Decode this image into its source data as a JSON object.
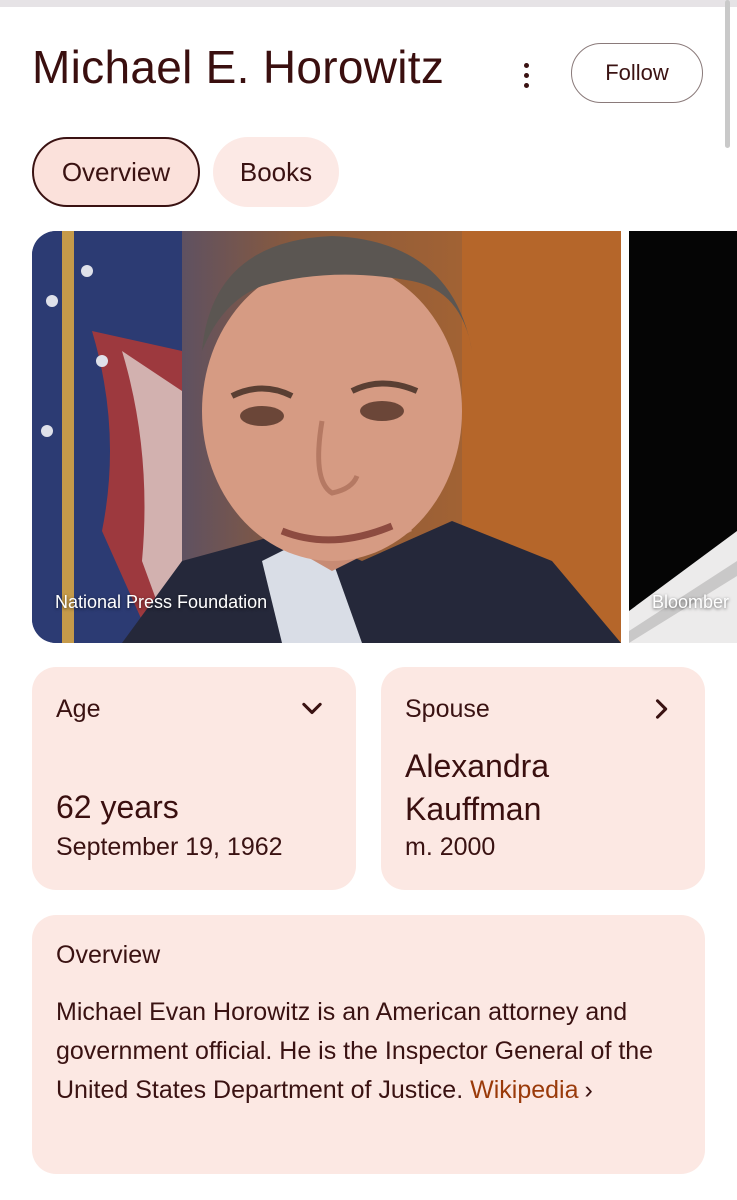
{
  "header": {
    "title": "Michael E. Horowitz",
    "more_icon": "more-vertical-icon",
    "follow_label": "Follow"
  },
  "tabs": [
    {
      "label": "Overview",
      "selected": true
    },
    {
      "label": "Books",
      "selected": false
    }
  ],
  "images": [
    {
      "caption": "National Press Foundation"
    },
    {
      "caption": "Bloomber"
    }
  ],
  "age_card": {
    "label": "Age",
    "icon": "chevron-down-icon",
    "value": "62 years",
    "sub": "September 19, 1962"
  },
  "spouse_card": {
    "label": "Spouse",
    "icon": "chevron-right-icon",
    "name": "Alexandra Kauffman",
    "sub": "m. 2000"
  },
  "overview": {
    "label": "Overview",
    "text": "Michael Evan Horowitz is an American attorney and government official. He is the Inspector General of the United States Department of Justice.",
    "link_label": "Wikipedia",
    "link_icon": "chevron-right-icon"
  },
  "colors": {
    "accent_text": "#3a1212",
    "card_bg": "#fce8e3",
    "link": "#9a3a0a"
  }
}
